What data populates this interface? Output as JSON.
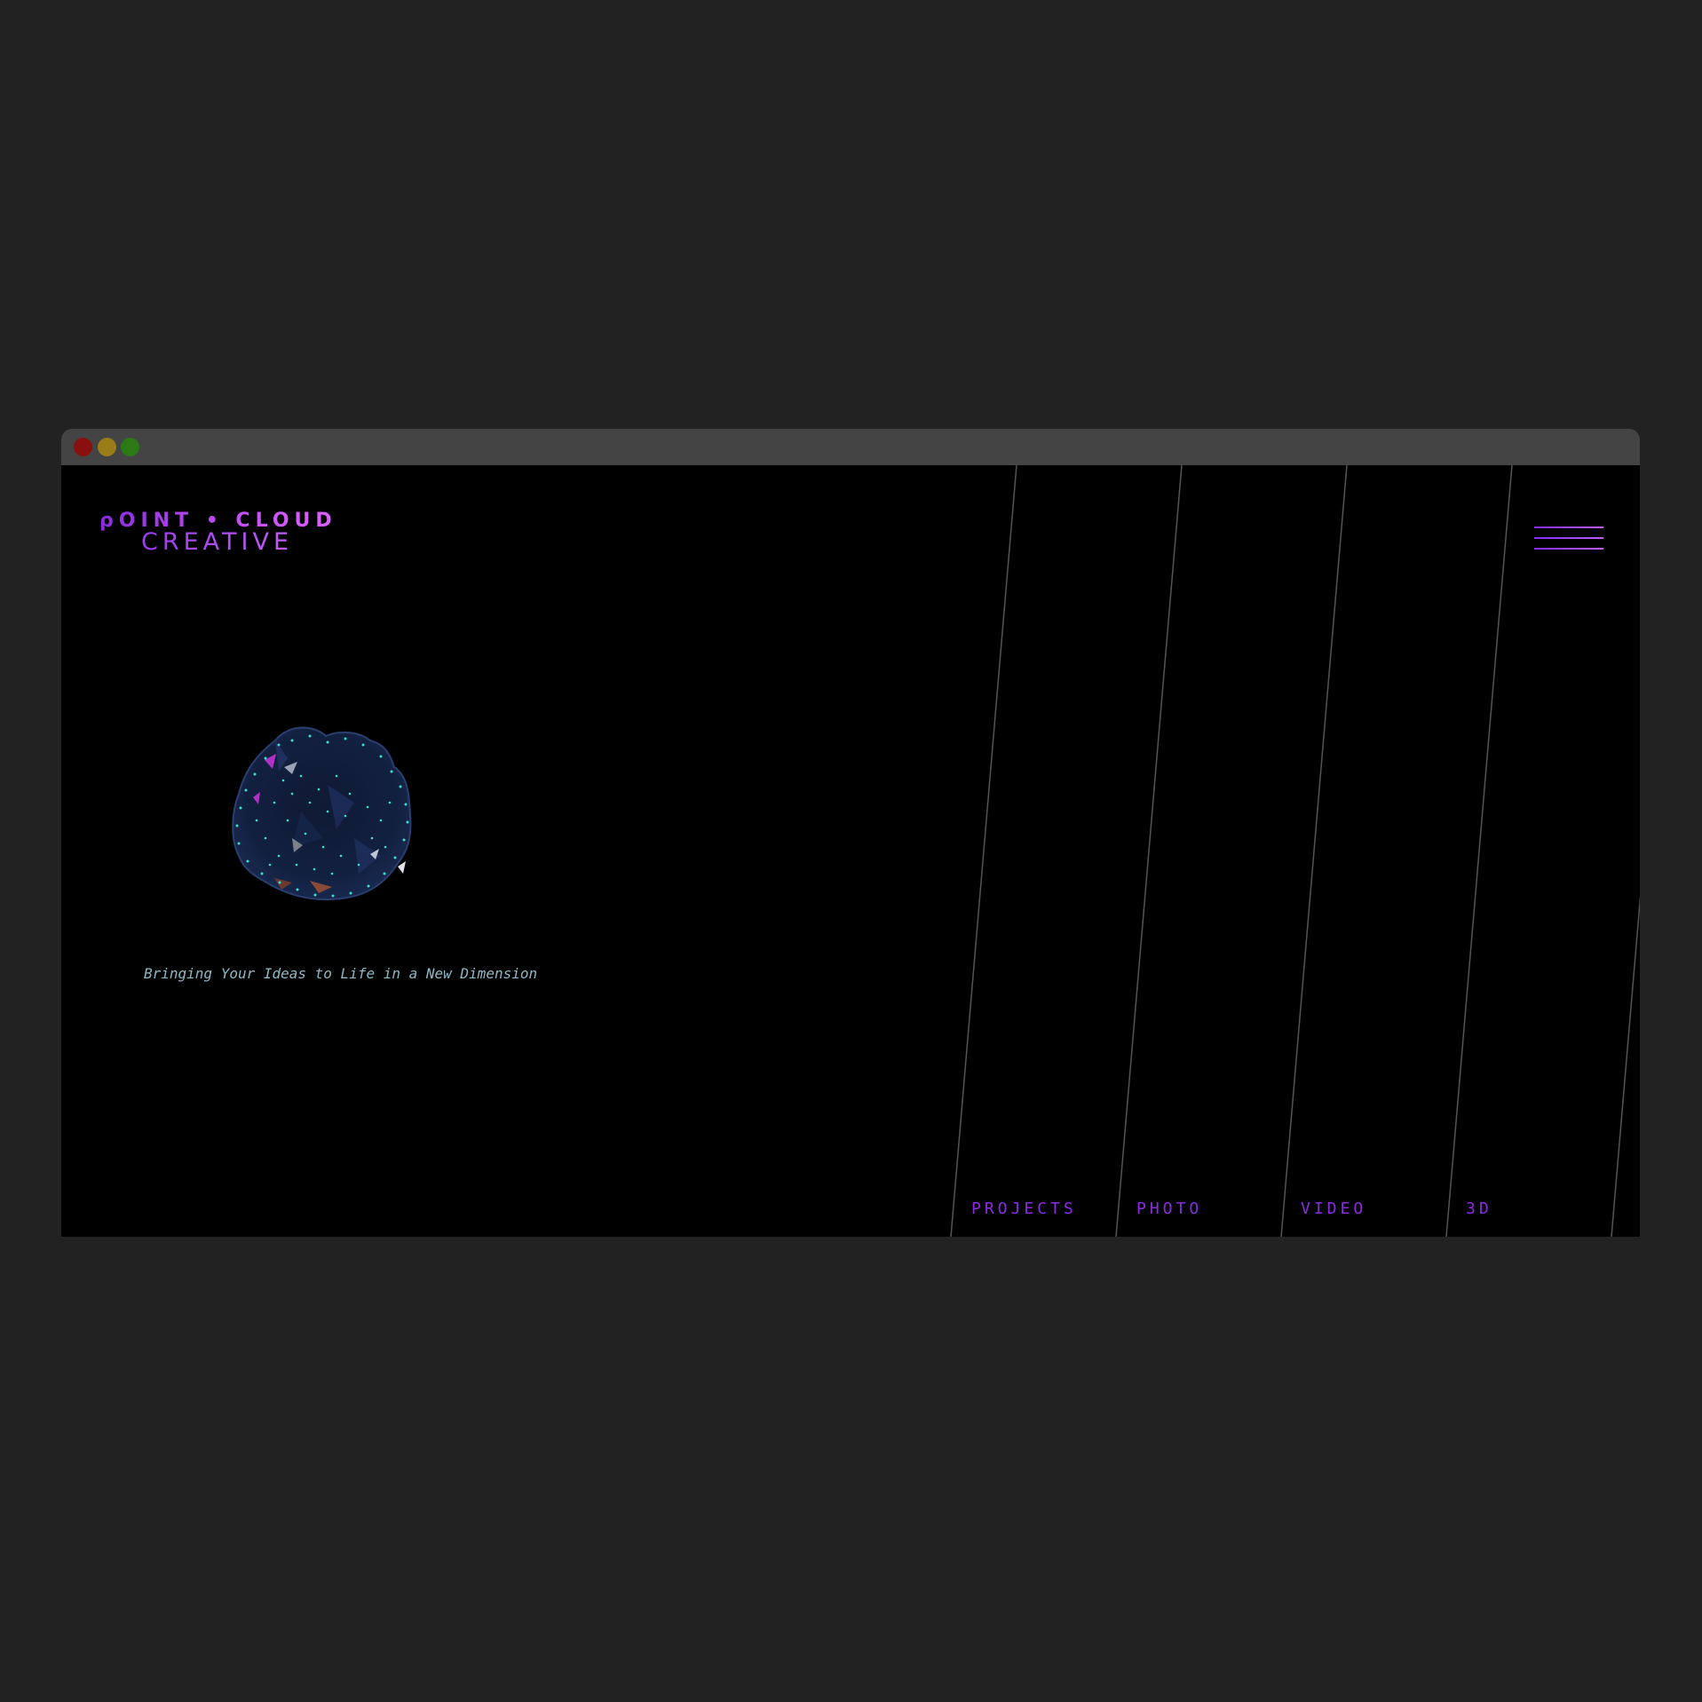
{
  "window": {
    "controls": [
      "close",
      "minimize",
      "maximize"
    ]
  },
  "logo": {
    "line1": "ρOINT • CLOUD",
    "line2": "CREATIVE"
  },
  "menu": {
    "icon": "hamburger-menu-icon"
  },
  "hero": {
    "image": "point-cloud-blob",
    "tagline": "Bringing Your Ideas to Life in a New Dimension"
  },
  "nav": {
    "items": [
      {
        "label": "PROJECTS"
      },
      {
        "label": "PHOTO"
      },
      {
        "label": "VIDEO"
      },
      {
        "label": "3D"
      }
    ]
  },
  "colors": {
    "page_bg": "#222222",
    "titlebar": "#444444",
    "viewport_bg": "#000000",
    "accent": "#8a2be2",
    "tagline": "#8fb8c6",
    "stripe": "#555555"
  }
}
